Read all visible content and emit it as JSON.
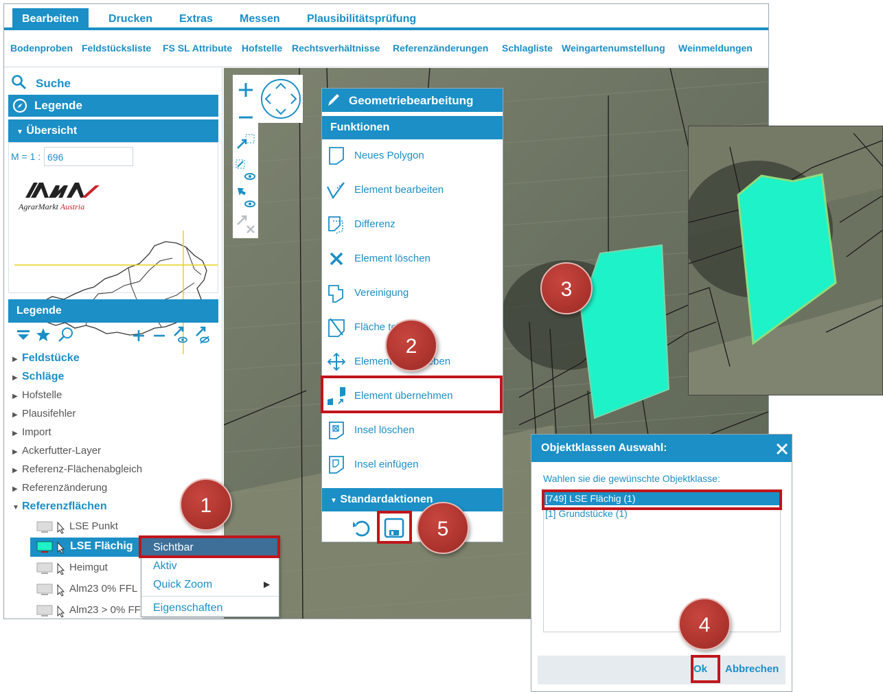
{
  "menubar": {
    "items": [
      "Bearbeiten",
      "Drucken",
      "Extras",
      "Messen",
      "Plausibilitätsprüfung"
    ],
    "active": "Bearbeiten"
  },
  "subbar": {
    "items": [
      "Bodenproben",
      "Feldstücksliste",
      "FS SL Attribute",
      "Hofstelle",
      "Rechtsverhältnisse",
      "Referenzänderungen",
      "Schlagliste",
      "Weingartenumstellung",
      "Weinmeldungen"
    ]
  },
  "sidebar": {
    "search_label": "Suche",
    "legend_label": "Legende",
    "overview_label": "Übersicht",
    "scale_prefix": "M = 1 :",
    "scale_value": "696",
    "logo_text": "AgrarMarkt Austria",
    "legend_panel_title": "Legende",
    "tree": [
      {
        "label": "Feldstücke",
        "style": "blue",
        "expanded": false
      },
      {
        "label": "Schläge",
        "style": "blue",
        "expanded": false
      },
      {
        "label": "Hofstelle",
        "style": "normal",
        "expanded": false
      },
      {
        "label": "Plausifehler",
        "style": "normal",
        "expanded": false
      },
      {
        "label": "Import",
        "style": "normal",
        "expanded": false
      },
      {
        "label": "Ackerfutter-Layer",
        "style": "normal",
        "expanded": false
      },
      {
        "label": "Referenz-Flächenabgleich",
        "style": "normal",
        "expanded": false
      },
      {
        "label": "Referenzänderung",
        "style": "normal",
        "expanded": false
      },
      {
        "label": "Referenzflächen",
        "style": "blue",
        "expanded": true
      }
    ],
    "layers": [
      {
        "label": "LSE Punkt",
        "selected": false
      },
      {
        "label": "LSE Flächig",
        "selected": true
      },
      {
        "label": "Heimgut",
        "selected": false
      },
      {
        "label": "Alm23 0% FFL",
        "selected": false
      },
      {
        "label": "Alm23 > 0% FFL",
        "selected": false
      }
    ]
  },
  "context_menu": {
    "items": [
      "Sichtbar",
      "Aktiv",
      "Quick Zoom",
      "Eigenschaften"
    ],
    "highlighted": "Sichtbar"
  },
  "geometry_panel": {
    "title": "Geometriebearbeitung",
    "functions_header": "Funktionen",
    "items": [
      {
        "label": "Neues Polygon",
        "icon": "new-polygon-icon"
      },
      {
        "label": "Element bearbeiten",
        "icon": "edit-element-icon"
      },
      {
        "label": "Differenz",
        "icon": "difference-icon"
      },
      {
        "label": "Element löschen",
        "icon": "delete-x-icon"
      },
      {
        "label": "Vereinigung",
        "icon": "union-icon"
      },
      {
        "label": "Fläche teilen",
        "icon": "split-area-icon"
      },
      {
        "label": "Element verschieben",
        "icon": "move-arrows-icon"
      },
      {
        "label": "Element übernehmen",
        "icon": "take-over-element-icon"
      },
      {
        "label": "Insel löschen",
        "icon": "delete-island-icon"
      },
      {
        "label": "Insel einfügen",
        "icon": "insert-island-icon"
      }
    ],
    "standard_header": "Standardaktionen"
  },
  "dialog": {
    "title": "Objektklassen Auswahl:",
    "prompt": "Wahlen sie die gewünschte Objektklasse:",
    "options": [
      "[749] LSE Flächig (1)",
      "[1] Grundstücke (1)"
    ],
    "selected": "[749] LSE Flächig (1)",
    "ok_label": "Ok",
    "cancel_label": "Abbrechen"
  },
  "badges": [
    "1",
    "2",
    "3",
    "4",
    "5"
  ],
  "colors": {
    "accent": "#1b8fc6",
    "highlight_box": "#c0151b",
    "badge": "#b13630",
    "polygon_fill": "#1ef2c8"
  }
}
